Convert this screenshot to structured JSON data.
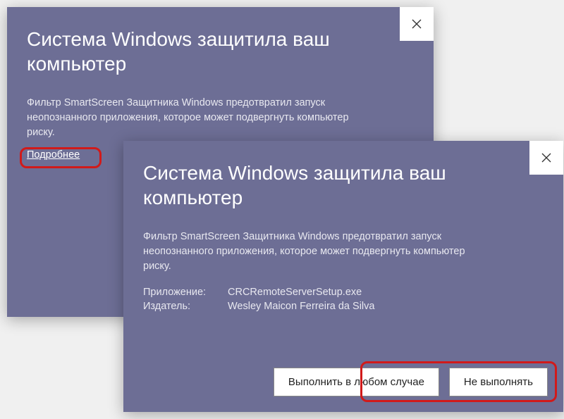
{
  "dialog1": {
    "title": "Система Windows защитила ваш компьютер",
    "body": "Фильтр SmartScreen Защитника Windows предотвратил запуск неопознанного приложения, которое может подвергнуть компьютер риску.",
    "more": "Подробнее"
  },
  "dialog2": {
    "title": "Система Windows защитила ваш компьютер",
    "body": "Фильтр SmartScreen Защитника Windows предотвратил запуск неопознанного приложения, которое может подвергнуть компьютер риску.",
    "app_label": "Приложение:",
    "app_value": "CRCRemoteServerSetup.exe",
    "publisher_label": "Издатель:",
    "publisher_value": "Wesley Maicon Ferreira da Silva",
    "run_anyway": "Выполнить в любом случае",
    "dont_run": "Не выполнять"
  }
}
